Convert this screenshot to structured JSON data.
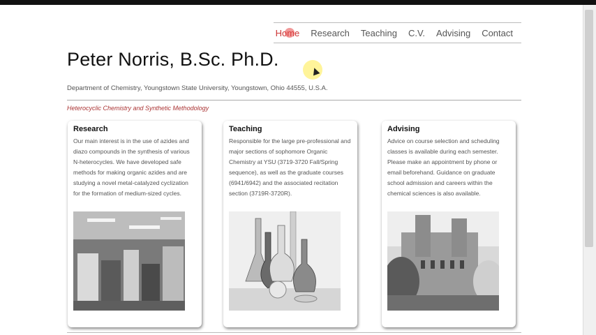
{
  "nav": {
    "items": [
      {
        "label": "Home",
        "active": true
      },
      {
        "label": "Research",
        "active": false
      },
      {
        "label": "Teaching",
        "active": false
      },
      {
        "label": "C.V.",
        "active": false
      },
      {
        "label": "Advising",
        "active": false
      },
      {
        "label": "Contact",
        "active": false
      }
    ]
  },
  "header": {
    "title": "Peter Norris, B.Sc. Ph.D.",
    "department": "Department of Chemistry, Youngstown State University, Youngstown, Ohio 44555, U.S.A.",
    "tagline": "Heterocyclic Chemistry and Synthetic Methodology"
  },
  "cards": [
    {
      "title": "Research",
      "text": "Our main interest is in the use of azides and diazo compounds in the synthesis of various N-heterocycles. We have developed safe methods for making organic azides and are studying a novel metal-catalyzed cyclization for the formation of medium-sized cycles.",
      "photo": "laboratory-photo"
    },
    {
      "title": "Teaching",
      "text": "Responsible for the large pre-professional and major sections of sophomore Organic Chemistry at YSU (3719-3720 Fall/Spring sequence), as well as the graduate courses (6941/6942) and the associated recitation section (3719R-3720R).",
      "photo": "glassware-photo"
    },
    {
      "title": "Advising",
      "text": "Advice on course selection and scheduling classes is available during each semester. Please make an appointment by phone or email beforehand. Guidance on graduate school admission and careers within the chemical sciences is also available.",
      "photo": "campus-building-photo"
    }
  ],
  "colors": {
    "accent": "#cc3333",
    "nav_text": "#555555",
    "topbar": "#111111"
  }
}
